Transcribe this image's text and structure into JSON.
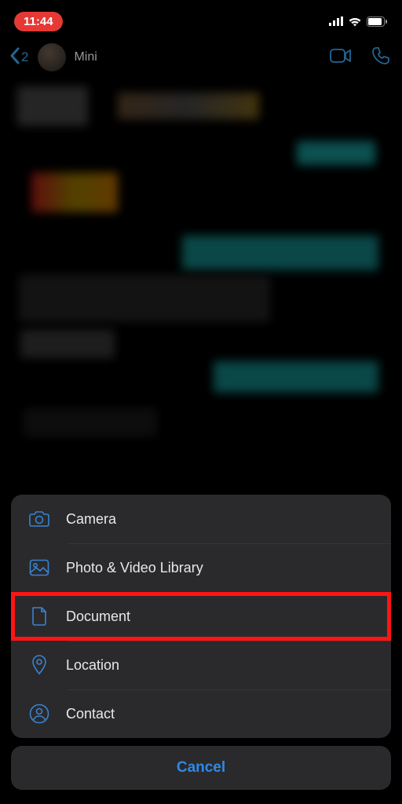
{
  "status_bar": {
    "time": "11:44"
  },
  "header": {
    "back_count": "2",
    "contact_name": "Mini"
  },
  "attachment_menu": {
    "items": [
      {
        "label": "Camera",
        "icon": "camera-icon"
      },
      {
        "label": "Photo & Video Library",
        "icon": "photo-icon"
      },
      {
        "label": "Document",
        "icon": "document-icon",
        "highlighted": true
      },
      {
        "label": "Location",
        "icon": "location-icon"
      },
      {
        "label": "Contact",
        "icon": "contact-icon"
      }
    ],
    "cancel_label": "Cancel"
  },
  "colors": {
    "accent": "#2f88e6",
    "icon_blue": "#3a82cf",
    "sheet_bg": "#2a2a2c",
    "highlight_red": "#ff1414",
    "time_pill": "#e53935"
  }
}
